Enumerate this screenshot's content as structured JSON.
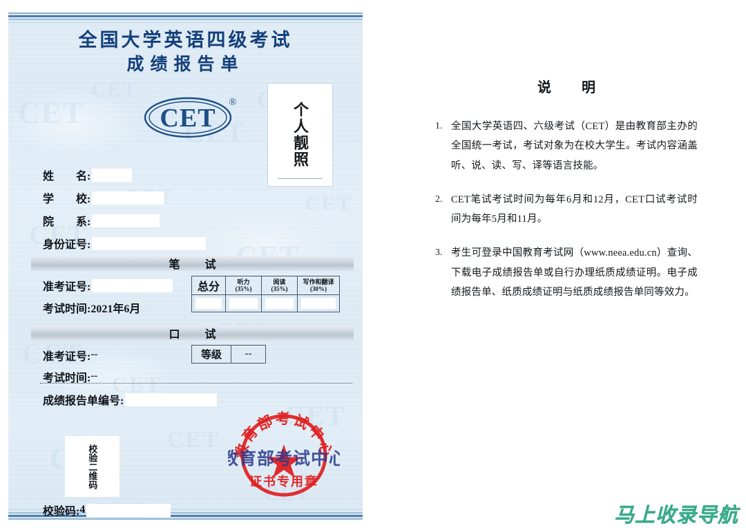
{
  "certificate": {
    "title_line1": "全国大学英语四级考试",
    "title_line2": "成绩报告单",
    "logo_text": "CET",
    "logo_mark": "®",
    "photo_placeholder": "个人靓照",
    "fields": [
      {
        "label": "姓　　名:",
        "name": "name-field",
        "value": "",
        "redact_width": 58
      },
      {
        "label": "学　　校:",
        "name": "school-field",
        "value": "",
        "redact_width": 105
      },
      {
        "label": "院　　系:",
        "name": "department-field",
        "value": "",
        "redact_width": 98
      },
      {
        "label": "身份证号:",
        "name": "id-number-field",
        "value": "",
        "redact_width": 165
      }
    ],
    "written": {
      "section_label": "笔　试",
      "ticket_label": "准考证号:",
      "ticket_value": "",
      "ticket_redact_width": 117,
      "date_label": "考试时间:",
      "date_value": "2021年6月",
      "score_table": {
        "headers": [
          "总分",
          "听力\n(35%)",
          "阅读\n(35%)",
          "写作和翻译\n(30%)"
        ],
        "header_total": "总分",
        "header_listening": "听力",
        "header_listening_weight": "(35%)",
        "header_reading": "阅读",
        "header_reading_weight": "(35%)",
        "header_writing": "写作和翻译",
        "header_writing_weight": "(30%)",
        "values": [
          "",
          "",
          "",
          ""
        ]
      }
    },
    "oral": {
      "section_label": "口　试",
      "ticket_label": "准考证号:",
      "ticket_value": "--",
      "date_label": "考试时间:",
      "date_value": "--",
      "grade_label": "等级",
      "grade_value": "--"
    },
    "report_number": {
      "label": "成绩报告单编号:",
      "value": "",
      "redact_width": 133
    },
    "qr": {
      "placeholder": "校验二维码"
    },
    "verify_code": {
      "label": "校验码:",
      "value": "4",
      "redact_width": 122
    },
    "seal": {
      "arc_text": "教育部考试中心",
      "bottom_text": "证书专用章",
      "overlay_text": "教育部考试中心",
      "color": "#e02020",
      "overlay_color": "#2a3a8c"
    },
    "background_watermark_text": "CET"
  },
  "explanation": {
    "title": "说　明",
    "items": [
      {
        "num": "1.",
        "text": "全国大学英语四、六级考试（CET）是由教育部主办的全国统一考试，考试对象为在校大学生。考试内容涵盖听、说、读、写、译等语言技能。"
      },
      {
        "num": "2.",
        "text": "CET笔试考试时间为每年6月和12月，CET口试考试时间为每年5月和11月。"
      },
      {
        "num": "3.",
        "text": "考生可登录中国教育考试网（www.neea.edu.cn）查询、下载电子成绩报告单或自行办理纸质成绩证明。电子成绩报告单、纸质成绩证明与纸质成绩报告单同等效力。"
      }
    ]
  },
  "site_watermark": {
    "text": "马上收录导航",
    "color": "#3bab8c"
  },
  "theme": {
    "title_color": "#14407a",
    "card_bg": "#dfeaf4",
    "seal_red": "#e02020"
  }
}
